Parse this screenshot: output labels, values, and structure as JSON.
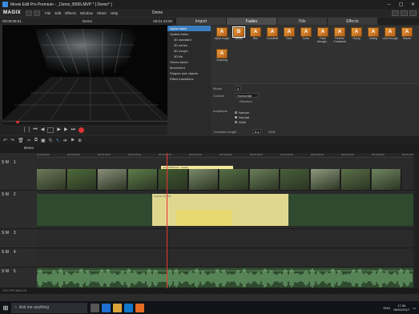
{
  "window": {
    "title": "Movie Edit Pro Premium - _Demo_B565.MVP * [ Demo* ]"
  },
  "menubar": {
    "logo": "MAGIX",
    "menus": [
      "File",
      "Edit",
      "Effects",
      "Window",
      "Share",
      "Help"
    ],
    "project_name": "Demo"
  },
  "preview": {
    "timecode_left": "00:00:09:01",
    "timecode_right": "00:01:43:00",
    "title": "Demo",
    "scrub_time": "00:01:42:00"
  },
  "tabs": [
    {
      "label": "Import"
    },
    {
      "label": "Fades"
    },
    {
      "label": "Title"
    },
    {
      "label": "Effects"
    }
  ],
  "fx_categories": [
    {
      "label": "Alpha fades",
      "sel": true
    },
    {
      "label": "Spatial fades",
      "sub": false
    },
    {
      "label": "3D standard",
      "sub": true
    },
    {
      "label": "3D series",
      "sub": true
    },
    {
      "label": "3D morph",
      "sub": true
    },
    {
      "label": "3D tile",
      "sub": true
    },
    {
      "label": "Stereo fades",
      "sub": false
    },
    {
      "label": "Movement",
      "sub": false
    },
    {
      "label": "Shapes and objects",
      "sub": false
    },
    {
      "label": "Effect transitions",
      "sub": false
    }
  ],
  "fx_items": [
    {
      "label": "Alpha magic",
      "glyph": "A"
    },
    {
      "label": "Blinds",
      "glyph": "B",
      "sel": true
    },
    {
      "label": "Blur",
      "glyph": "A"
    },
    {
      "label": "Colorfade",
      "glyph": "A"
    },
    {
      "label": "Door",
      "glyph": "A"
    },
    {
      "label": "Draw",
      "glyph": "A"
    },
    {
      "label": "Fade through...",
      "glyph": "A"
    },
    {
      "label": "Flexible Crossfade",
      "glyph": "A"
    },
    {
      "label": "Flying",
      "glyph": "A"
    },
    {
      "label": "Gliding",
      "glyph": "A"
    },
    {
      "label": "Leaf through",
      "glyph": "A"
    },
    {
      "label": "Waves",
      "glyph": "A"
    },
    {
      "label": "Zooming",
      "glyph": "A"
    }
  ],
  "fx_props": {
    "blinds_label": "Blinds",
    "blinds_value": "4",
    "content_label": "Content",
    "content_value": "Horizontal",
    "direction_label": "Direction",
    "amplitude_label": "Amplitude",
    "radio_options": [
      {
        "label": "Narrow",
        "on": false
      },
      {
        "label": "Normal",
        "on": true
      },
      {
        "label": "Wide",
        "on": false
      }
    ],
    "duration_label": "Transition length",
    "duration_value": "5 s",
    "duration_unit": "AGB"
  },
  "timeline": {
    "tab": "Demo",
    "ruler_ticks": [
      "00:00:00:00",
      "00:00:05:00",
      "00:00:10:00",
      "00:00:15:00",
      "00:00:20:00",
      "00:00:25:00",
      "00:00:30:00",
      "00:00:35:00",
      "00:00:40:00",
      "00:00:45:00",
      "00:00:50:00",
      "00:00:55:00",
      "00:01:00:00"
    ],
    "selection_label": "pres 3/68 fr/sec - Fade1",
    "audio_clip_label": "Audio3 125 0dB",
    "tracks": [
      {
        "n": "1"
      },
      {
        "n": "2"
      },
      {
        "n": "3"
      },
      {
        "n": "4"
      },
      {
        "n": "5"
      }
    ],
    "track_flags": "S M"
  },
  "statusbar": {
    "text": "CPU  DPR  MM 6.03"
  },
  "taskbar": {
    "search_placeholder": "Ask me anything",
    "lang": "ENG",
    "time": "17:06",
    "date": "08/02/2017"
  },
  "colors": {
    "accent": "#3b7ec0",
    "selection": "#f4e79a",
    "playhead": "#e33"
  }
}
